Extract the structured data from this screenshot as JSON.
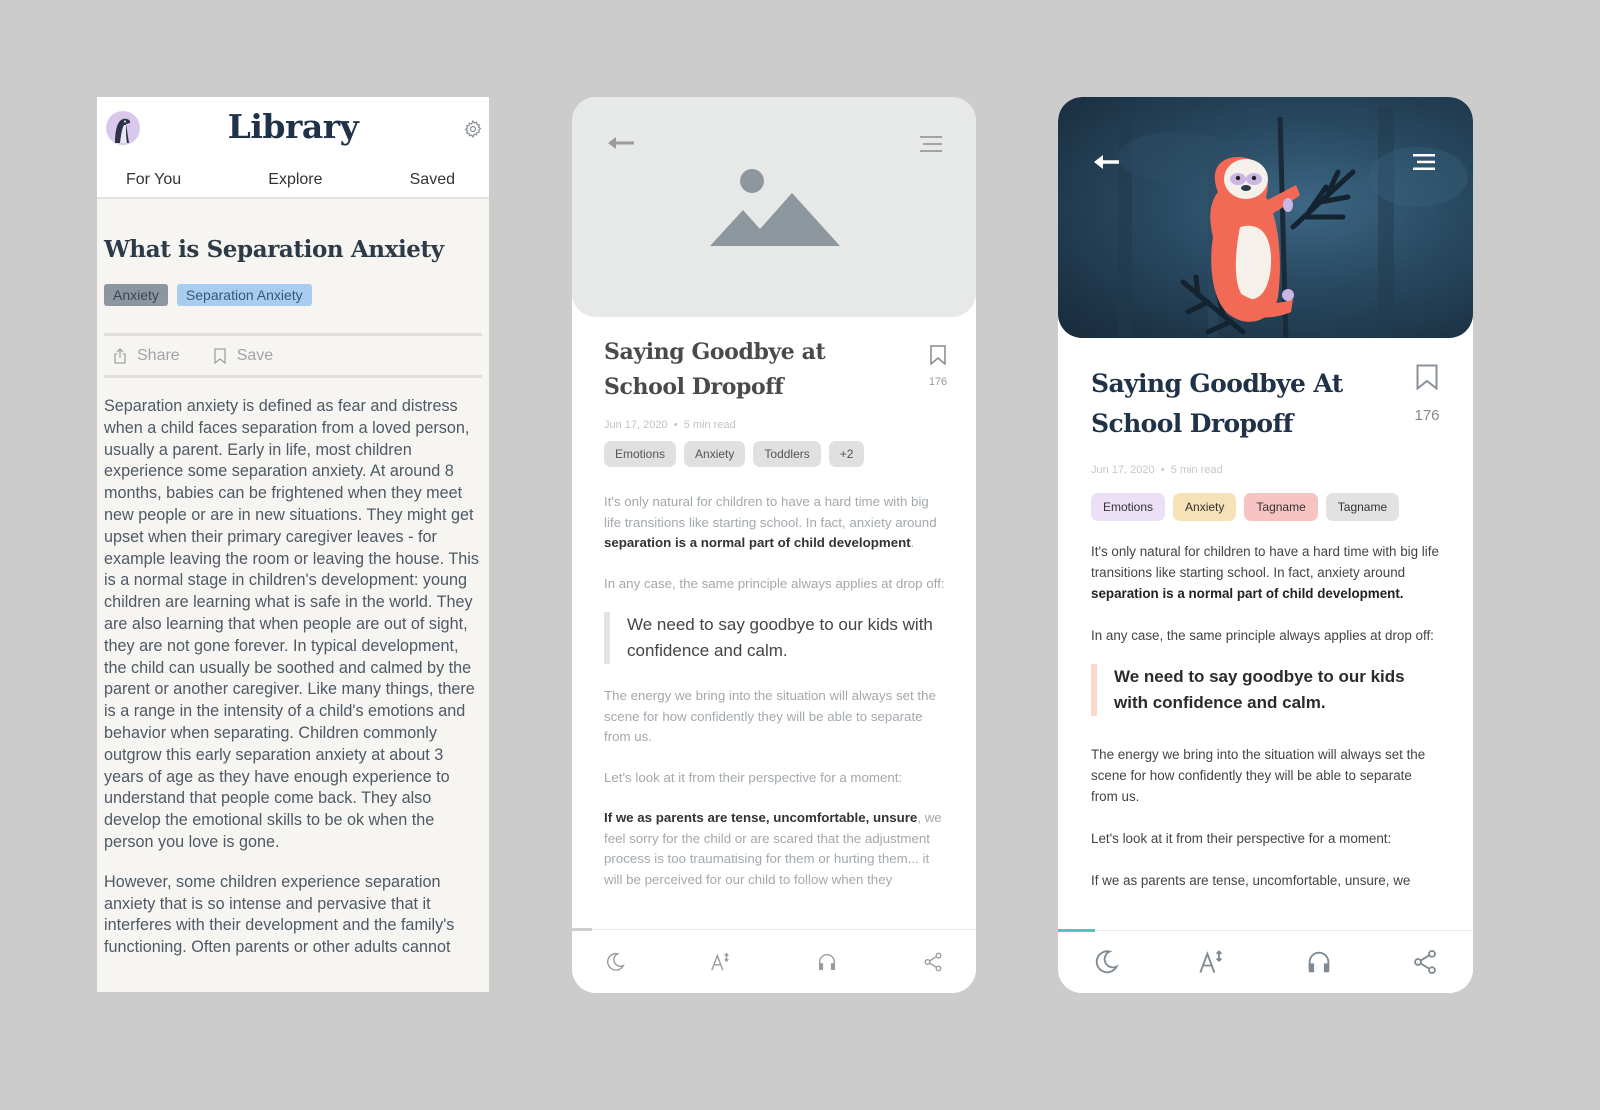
{
  "library": {
    "title": "Library",
    "tabs": [
      {
        "label": "For You"
      },
      {
        "label": "Explore"
      },
      {
        "label": "Saved"
      }
    ],
    "article": {
      "title": "What is Separation Anxiety",
      "tags": [
        {
          "label": "Anxiety",
          "color": "#8c96a0"
        },
        {
          "label": "Separation Anxiety",
          "color": "#a8cdef"
        }
      ],
      "actions": {
        "share": "Share",
        "save": "Save"
      },
      "paragraphs": [
        "Separation anxiety is defined as fear and distress when a child faces separation from a loved person, usually a parent. Early in life, most children experience some separation anxiety. At around 8 months, babies can be frightened when they meet new people or are in new situations. They might get upset when their primary caregiver leaves - for example leaving the room or leaving the house. This is a normal stage in children's development: young children are learning what is safe in the world. They are also learning that when people are out of sight, they are not gone forever. In typical development, the child can usually be soothed and calmed by the parent or another caregiver. Like many things, there is a range in the intensity of a child's emotions and behavior when separating. Children commonly outgrow this early separation anxiety at about 3 years of age as they have enough experience to understand that people come back. They also develop the emotional skills to be ok when the person you love is gone.",
        "However, some children experience separation anxiety that is so intense and pervasive that it interferes with their development and the family's functioning. Often parents or other adults cannot"
      ]
    }
  },
  "wireframe": {
    "article": {
      "title": "Saying Goodbye at School Dropoff",
      "save_count": "176",
      "date": "Jun 17, 2020",
      "read_time": "5 min read",
      "tags": [
        {
          "label": "Emotions"
        },
        {
          "label": "Anxiety"
        },
        {
          "label": "Toddlers"
        },
        {
          "label": "+2"
        }
      ],
      "p1_plain": "It's only natural for children to have a hard time with big life transitions like starting school. In fact, anxiety around ",
      "p1_bold": "separation is a normal part of child development",
      "p1_end": ".",
      "p2": "In any case, the same principle always applies at drop off:",
      "quote": "We need to say goodbye to our kids with confidence and calm.",
      "p3": "The energy we bring into the situation will always set the scene for how confidently they will be able to separate from us.",
      "p4": "Let's look at it from their perspective for a moment:",
      "p5_bold": "If we as parents are tense, uncomfortable, unsure",
      "p5_plain": ", we feel sorry for the child or are scared that the adjustment process is too traumatising for them or hurting them... it will be perceived for our child to follow when they"
    },
    "reading_progress": 0.05
  },
  "final": {
    "article": {
      "title": "Saying Goodbye At School Dropoff",
      "save_count": "176",
      "date": "Jun 17, 2020",
      "read_time": "5 min read",
      "tags": [
        {
          "label": "Emotions",
          "color": "#ebe0f5"
        },
        {
          "label": "Anxiety",
          "color": "#f7e2b8"
        },
        {
          "label": "Tagname",
          "color": "#f7c3c3"
        },
        {
          "label": "Tagname",
          "color": "#e2e2e2"
        }
      ],
      "p1_plain": "It's only natural for children to have a hard time with big life transitions like starting school. In fact, anxiety around ",
      "p1_bold": "separation is a normal part of child development.",
      "p2": "In any case, the same principle always applies at drop off:",
      "quote": "We need to say goodbye to our kids with confidence and calm.",
      "p3": "The energy we bring into the situation will always set the scene for how confidently they will be able to separate from us.",
      "p4": "Let's look at it from their perspective for a moment:",
      "p5": "If we as parents are tense, uncomfortable, unsure, we"
    },
    "reading_progress": 0.09,
    "accent_color": "#58c2bf"
  },
  "toolbar_icons": [
    "moon-icon",
    "text-size-icon",
    "headphones-icon",
    "share-icon"
  ]
}
